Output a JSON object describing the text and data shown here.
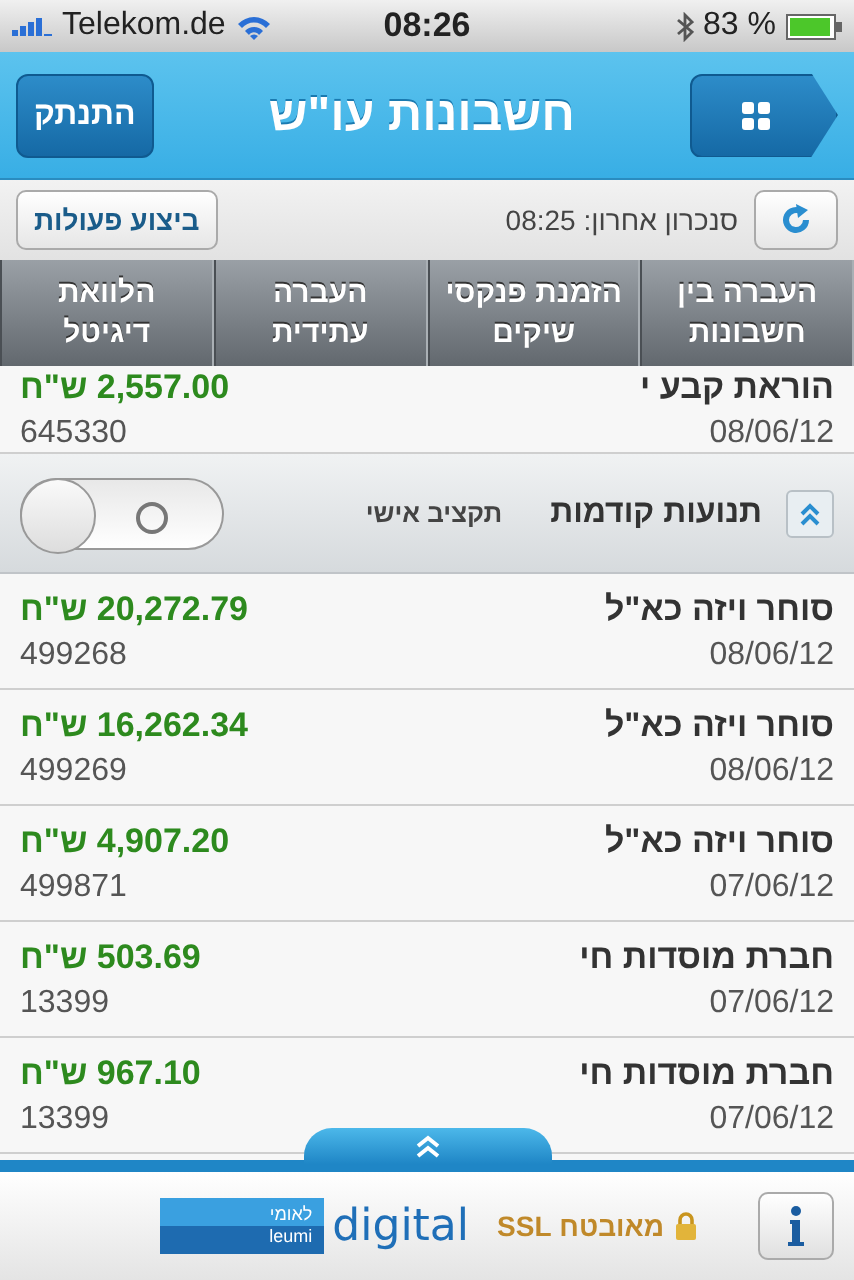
{
  "status_bar": {
    "carrier": "Telekom.de",
    "time": "08:26",
    "battery": "83 %"
  },
  "header": {
    "title": "חשבונות עו\"ש",
    "logout": "התנתק"
  },
  "sync_bar": {
    "sync_text": "סנכרון אחרון: 08:25",
    "actions": "ביצוע פעולות"
  },
  "tabs": [
    {
      "label": "העברה בין\nחשבונות"
    },
    {
      "label": "הזמנת פנקסי\nשיקים"
    },
    {
      "label": "העברה\nעתידית"
    },
    {
      "label": "הלוואת\nדיגיטל"
    }
  ],
  "first_row": {
    "name": "הוראת קבע י",
    "date": "08/06/12",
    "amount": "2,557.00 ש\"ח",
    "reference": "645330"
  },
  "previous_section": {
    "title": "תנועות קודמות",
    "budget_label": "תקציב אישי",
    "budget_on": false
  },
  "transactions": [
    {
      "name": "סוחר ויזה כא\"ל",
      "date": "08/06/12",
      "amount": "20,272.79 ש\"ח",
      "reference": "499268"
    },
    {
      "name": "סוחר ויזה כא\"ל",
      "date": "08/06/12",
      "amount": "16,262.34 ש\"ח",
      "reference": "499269"
    },
    {
      "name": "סוחר ויזה כא\"ל",
      "date": "07/06/12",
      "amount": "4,907.20 ש\"ח",
      "reference": "499871"
    },
    {
      "name": "חברת מוסדות חי",
      "date": "07/06/12",
      "amount": "503.69 ש\"ח",
      "reference": "13399"
    },
    {
      "name": "חברת מוסדות חי",
      "date": "07/06/12",
      "amount": "967.10 ש\"ח",
      "reference": "13399"
    }
  ],
  "footer": {
    "security": "מאובטח SSL",
    "logo_hebrew": "לאומי",
    "logo_latin": "leumi",
    "logo_word": "digital"
  }
}
